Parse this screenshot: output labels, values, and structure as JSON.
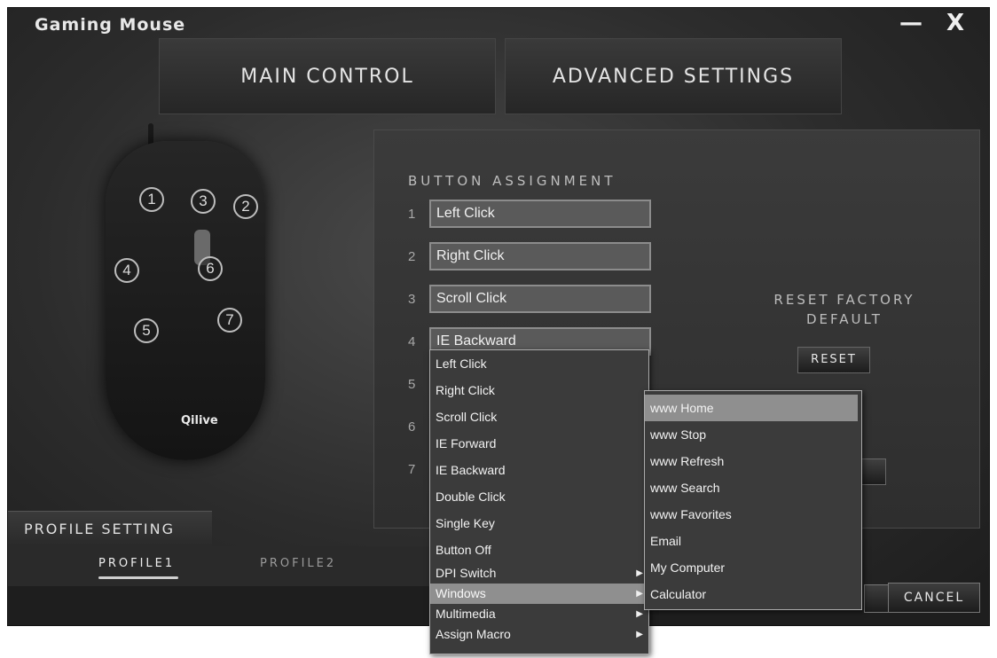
{
  "window": {
    "title": "Gaming Mouse",
    "minimize": "—",
    "close": "X"
  },
  "tabs": [
    {
      "label": "MAIN CONTROL"
    },
    {
      "label": "ADVANCED SETTINGS"
    }
  ],
  "mouse": {
    "logo": "Qilive",
    "buttons": [
      "1",
      "2",
      "3",
      "4",
      "5",
      "6",
      "7"
    ]
  },
  "button_assignment": {
    "title": "BUTTON ASSIGNMENT",
    "rows": [
      {
        "num": "1",
        "value": "Left Click"
      },
      {
        "num": "2",
        "value": "Right Click"
      },
      {
        "num": "3",
        "value": "Scroll Click"
      },
      {
        "num": "4",
        "value": "IE Backward"
      },
      {
        "num": "5"
      },
      {
        "num": "6"
      },
      {
        "num": "7"
      }
    ]
  },
  "reset": {
    "label_line1": "RESET FACTORY",
    "label_line2": "DEFAULT",
    "button": "RESET"
  },
  "profile": {
    "title": "PROFILE SETTING",
    "items": [
      "PROFILE1",
      "PROFILE2"
    ]
  },
  "footer": {
    "cancel": "CANCEL"
  },
  "dropdown": {
    "items": [
      "Left Click",
      "Right Click",
      "Scroll Click",
      "IE Forward",
      "IE Backward",
      "Double Click",
      "Single Key",
      "Button Off",
      "DPI Switch",
      "Windows",
      "Multimedia",
      "Assign Macro"
    ],
    "selected": "Windows"
  },
  "submenu": {
    "items": [
      "www Home",
      "www Stop",
      "www Refresh",
      "www Search",
      "www Favorites",
      "Email",
      "My Computer",
      "Calculator"
    ],
    "selected": "www Home"
  },
  "colors": {
    "background": "#2c2c2c",
    "highlight": "#8f8f8f",
    "text": "#f2f2f2"
  }
}
